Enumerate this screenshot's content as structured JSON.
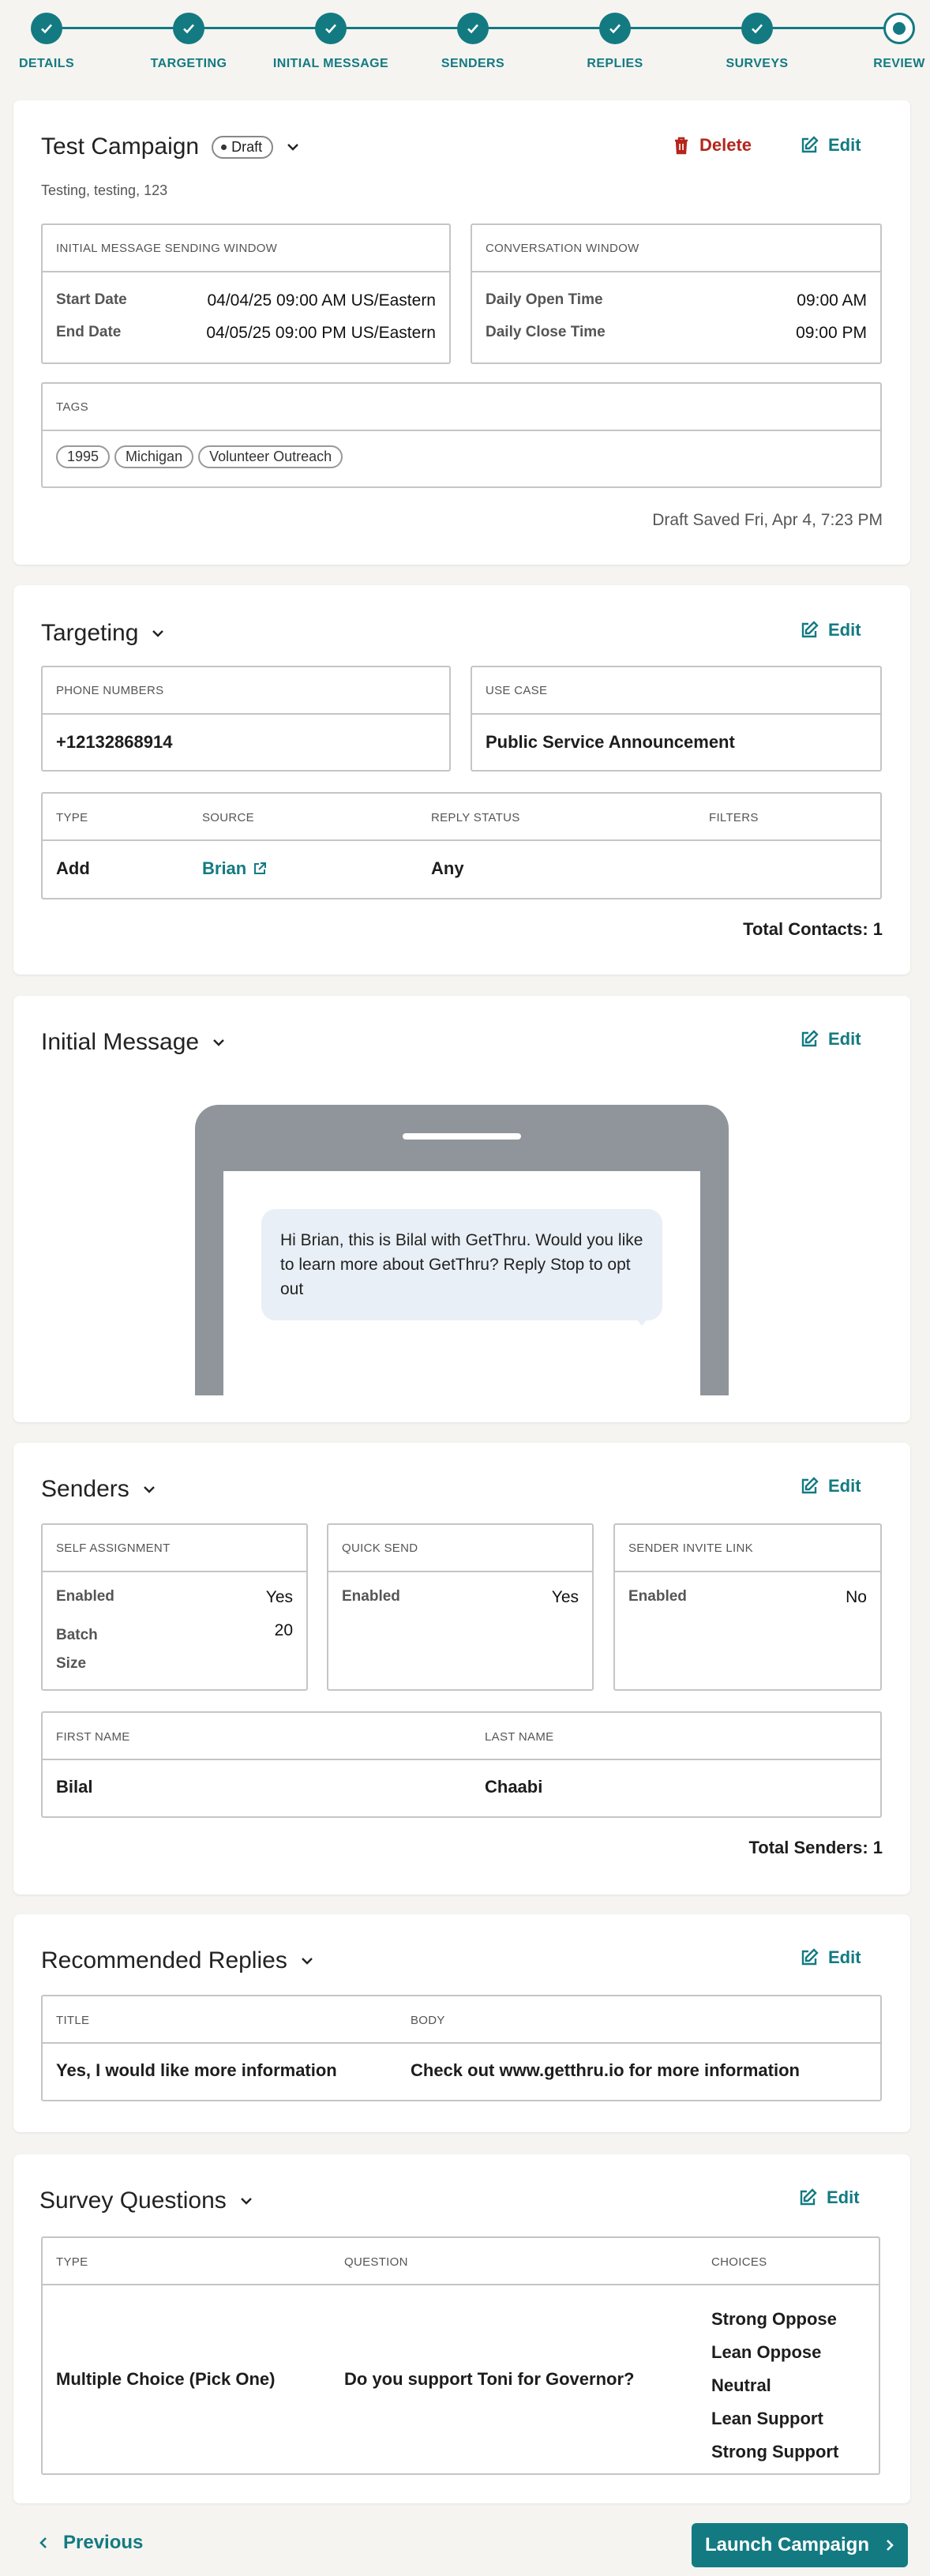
{
  "steps": [
    {
      "label": "DETAILS",
      "done": true
    },
    {
      "label": "TARGETING",
      "done": true
    },
    {
      "label": "INITIAL MESSAGE",
      "done": true
    },
    {
      "label": "SENDERS",
      "done": true
    },
    {
      "label": "REPLIES",
      "done": true
    },
    {
      "label": "SURVEYS",
      "done": true
    },
    {
      "label": "REVIEW",
      "done": false
    }
  ],
  "details": {
    "title": "Test Campaign",
    "status_badge": "Draft",
    "description": "Testing, testing, 123",
    "delete_label": "Delete",
    "edit_label": "Edit",
    "sending_window": {
      "header": "INITIAL MESSAGE SENDING WINDOW",
      "start_label": "Start Date",
      "start_value": "04/04/25 09:00 AM US/Eastern",
      "end_label": "End Date",
      "end_value": "04/05/25 09:00 PM US/Eastern"
    },
    "conversation_window": {
      "header": "CONVERSATION WINDOW",
      "open_label": "Daily Open Time",
      "open_value": "09:00 AM",
      "close_label": "Daily Close Time",
      "close_value": "09:00 PM"
    },
    "tags": {
      "header": "TAGS",
      "items": [
        "1995",
        "Michigan",
        "Volunteer Outreach"
      ]
    },
    "saved_text": "Draft Saved Fri, Apr 4, 7:23 PM"
  },
  "targeting": {
    "title": "Targeting",
    "edit_label": "Edit",
    "phone_header": "PHONE NUMBERS",
    "phone_value": "+12132868914",
    "usecase_header": "USE CASE",
    "usecase_value": "Public Service Announcement",
    "columns": [
      "TYPE",
      "SOURCE",
      "REPLY STATUS",
      "FILTERS"
    ],
    "row": {
      "type": "Add",
      "source": "Brian",
      "reply_status": "Any",
      "filters": ""
    },
    "total": "Total Contacts: 1"
  },
  "initial_message": {
    "title": "Initial Message",
    "edit_label": "Edit",
    "message": "Hi Brian, this is Bilal with GetThru. Would you like to learn more about GetThru? Reply Stop to opt out"
  },
  "senders": {
    "title": "Senders",
    "edit_label": "Edit",
    "self_assignment": {
      "header": "SELF ASSIGNMENT",
      "enabled_label": "Enabled",
      "enabled_value": "Yes",
      "batch_label": "Batch Size",
      "batch_value": "20"
    },
    "quick_send": {
      "header": "QUICK SEND",
      "enabled_label": "Enabled",
      "enabled_value": "Yes"
    },
    "invite_link": {
      "header": "SENDER INVITE LINK",
      "enabled_label": "Enabled",
      "enabled_value": "No"
    },
    "columns": [
      "FIRST NAME",
      "LAST NAME"
    ],
    "row": {
      "first": "Bilal",
      "last": "Chaabi"
    },
    "total": "Total Senders: 1"
  },
  "replies": {
    "title": "Recommended Replies",
    "edit_label": "Edit",
    "columns": [
      "TITLE",
      "BODY"
    ],
    "row": {
      "title": "Yes, I would like more information",
      "body": "Check out www.getthru.io for more information"
    }
  },
  "surveys": {
    "title": "Survey Questions",
    "edit_label": "Edit",
    "columns": [
      "TYPE",
      "QUESTION",
      "CHOICES"
    ],
    "row": {
      "type": "Multiple Choice (Pick One)",
      "question": "Do you support Toni for Governor?",
      "choices": [
        "Strong Oppose",
        "Lean Oppose",
        "Neutral",
        "Lean Support",
        "Strong Support"
      ]
    }
  },
  "footer": {
    "previous_label": "Previous",
    "launch_label": "Launch Campaign"
  },
  "colors": {
    "accent": "#137a82",
    "danger": "#b3261e"
  }
}
